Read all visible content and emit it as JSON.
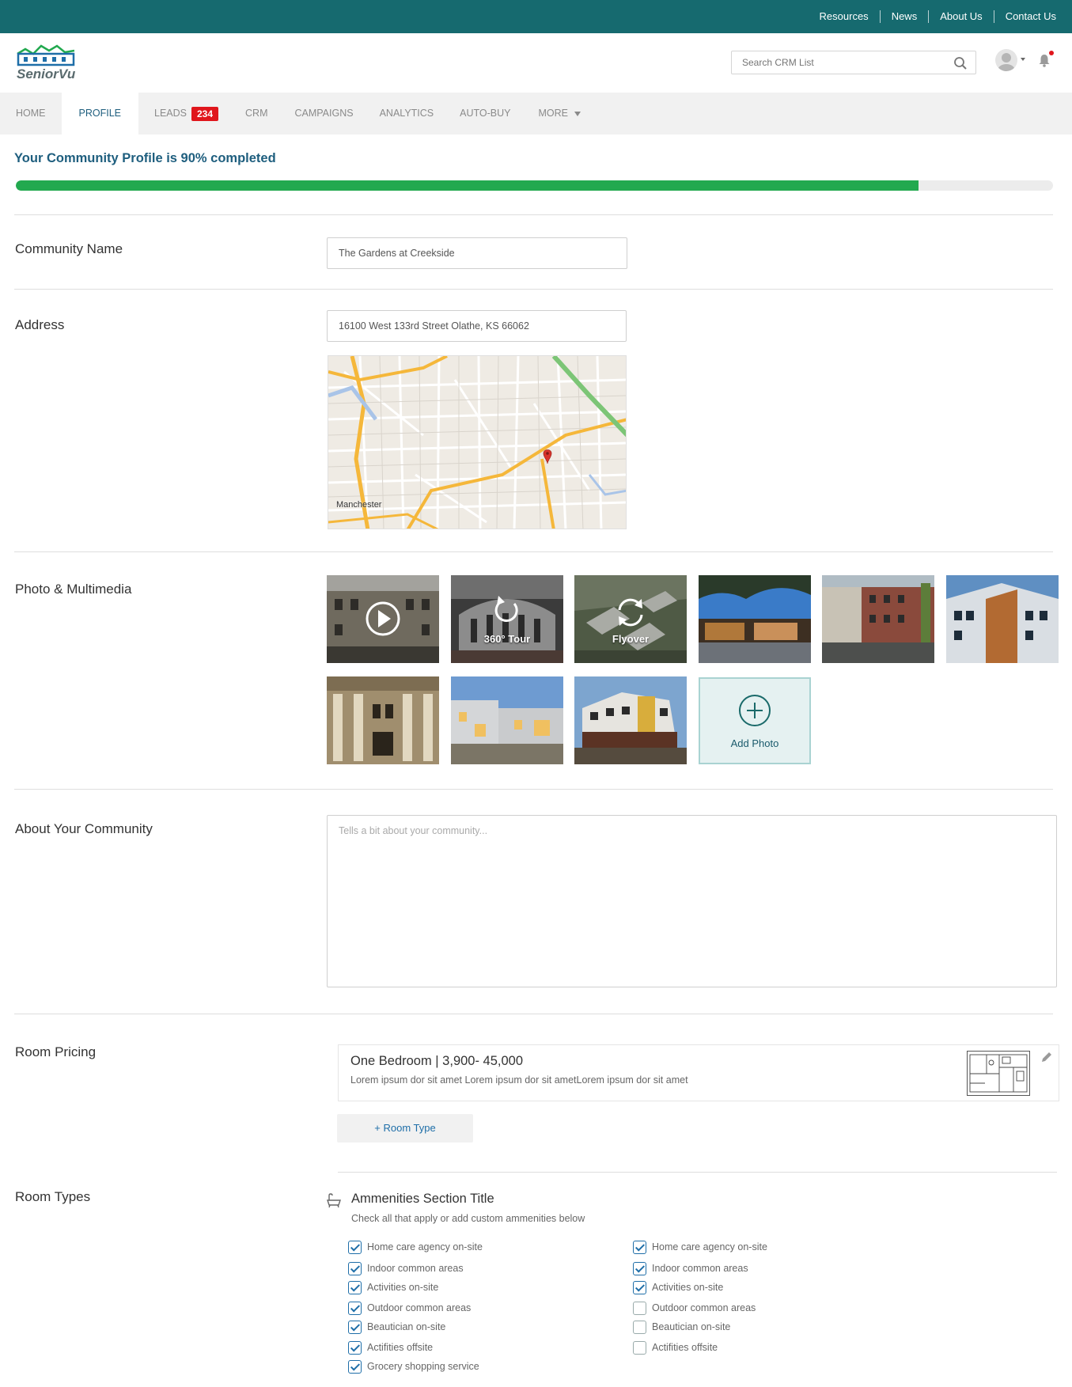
{
  "top_links": [
    "Resources",
    "News",
    "About Us",
    "Contact Us"
  ],
  "brand": {
    "name": "SeniorVu",
    "accent": "#166a6f"
  },
  "search": {
    "placeholder": "Search CRM List"
  },
  "nav": {
    "items": [
      {
        "label": "HOME",
        "active": false
      },
      {
        "label": "PROFILE",
        "active": true
      },
      {
        "label": "LEADS",
        "badge": "234",
        "active": false
      },
      {
        "label": "CRM",
        "active": false
      },
      {
        "label": "CAMPAIGNS",
        "active": false
      },
      {
        "label": "ANALYTICS",
        "active": false
      },
      {
        "label": "AUTO-BUY",
        "active": false
      },
      {
        "label": "MORE",
        "dropdown": true,
        "active": false
      }
    ]
  },
  "profile": {
    "completion_text": "Your Community Profile is 90% completed",
    "completion_fraction": 0.87,
    "progress_color": "#22a94f"
  },
  "sections": {
    "community_name": {
      "label": "Community Name",
      "value": "The Gardens at Creekside"
    },
    "address": {
      "label": "Address",
      "value": "16100 West 133rd Street Olathe, KS 66062",
      "map_label": "Manchester"
    },
    "photos": {
      "label": "Photo & Multimedia",
      "tour_label": "360° Tour",
      "flyover_label": "Flyover",
      "add_label": "Add Photo"
    },
    "about": {
      "label": "About Your Community",
      "placeholder": "Tells a bit about your community..."
    },
    "room_pricing": {
      "label": "Room Pricing",
      "rooms": [
        {
          "title": "One Bedroom | 3,900- 45,000",
          "description": "Lorem ipsum dor sit amet Lorem ipsum dor sit ametLorem ipsum dor sit amet"
        }
      ],
      "add_button": "+ Room Type"
    },
    "room_types": {
      "label": "Room Types",
      "amenities_title": "Ammenities Section Title",
      "amenities_subtitle": "Check all that apply or add custom ammenities below",
      "left_column": [
        {
          "label": "Home care agency on-site",
          "checked": true
        },
        {
          "label": "Indoor common areas",
          "checked": true
        },
        {
          "label": "Activities on-site",
          "checked": true
        },
        {
          "label": "Outdoor common areas",
          "checked": true
        },
        {
          "label": "Beautician on-site",
          "checked": true
        },
        {
          "label": "Actifities offsite",
          "checked": true
        },
        {
          "label": "Grocery shopping service",
          "checked": true
        }
      ],
      "right_column": [
        {
          "label": "Home care agency on-site",
          "checked": true
        },
        {
          "label": "Indoor common areas",
          "checked": true
        },
        {
          "label": "Activities on-site",
          "checked": true
        },
        {
          "label": "Outdoor common areas",
          "checked": false
        },
        {
          "label": "Beautician on-site",
          "checked": false
        },
        {
          "label": "Actifities offsite",
          "checked": false
        }
      ]
    }
  }
}
